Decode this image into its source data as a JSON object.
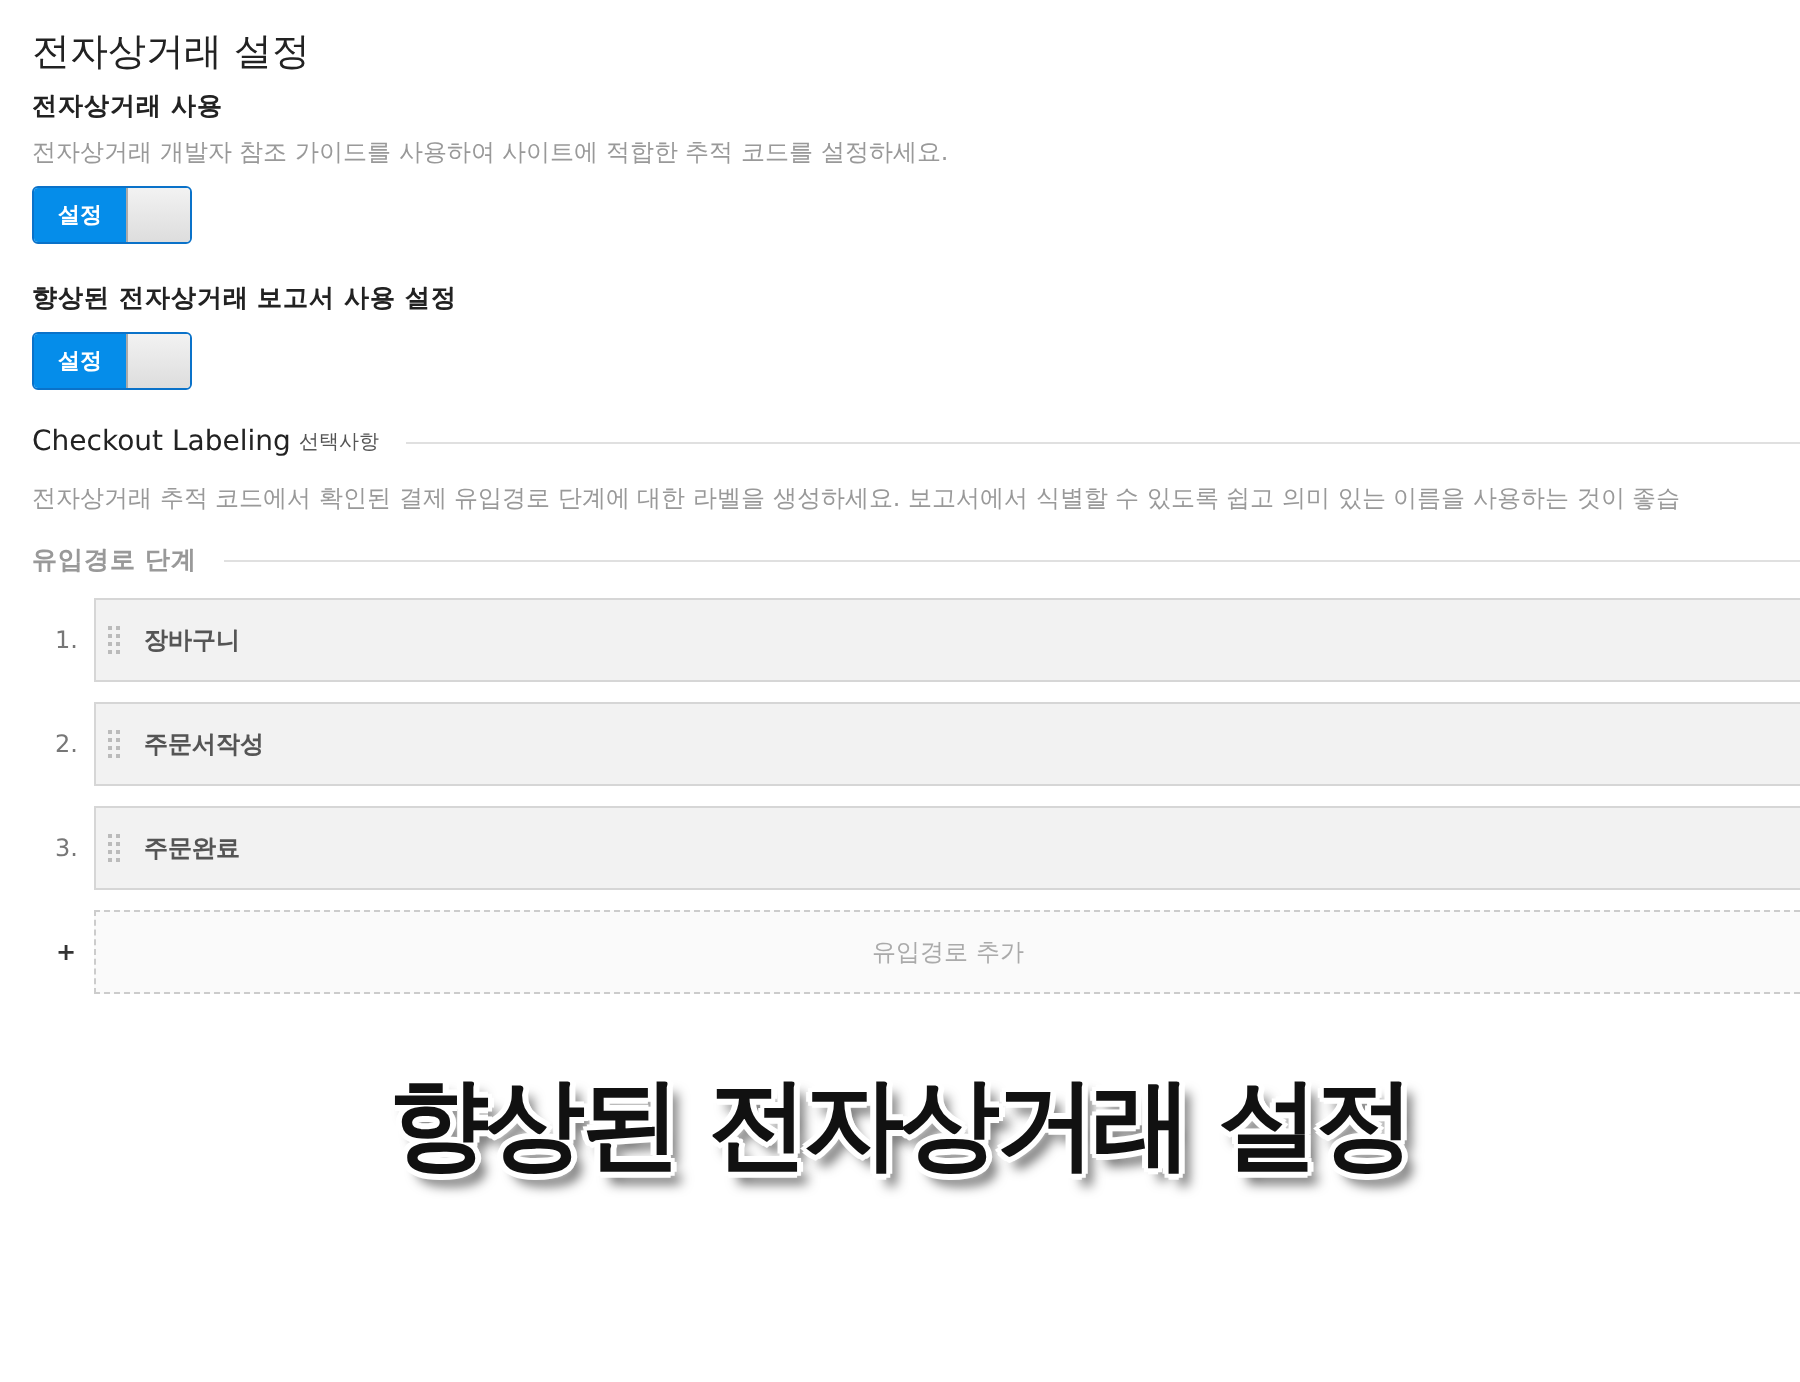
{
  "title": "전자상거래 설정",
  "settings": [
    {
      "label": "전자상거래 사용",
      "description": "전자상거래 개발자 참조 가이드를 사용하여 사이트에 적합한 추적 코드를 설정하세요.",
      "toggle": {
        "label": "설정",
        "on": true
      }
    },
    {
      "label": "향상된 전자상거래 보고서 사용 설정",
      "toggle": {
        "label": "설정",
        "on": true
      }
    }
  ],
  "checkout": {
    "title": "Checkout Labeling",
    "optional": "선택사항",
    "description": "전자상거래 추적 코드에서 확인된 결제 유입경로 단계에 대한 라벨을 생성하세요. 보고서에서 식별할 수 있도록 쉽고 의미 있는 이름을 사용하는 것이 좋습",
    "steps_heading": "유입경로 단계",
    "steps": [
      {
        "number": "1.",
        "name": "장바구니"
      },
      {
        "number": "2.",
        "name": "주문서작성"
      },
      {
        "number": "3.",
        "name": "주문완료"
      }
    ],
    "add": {
      "symbol": "+",
      "label": "유입경로 추가"
    }
  },
  "caption": "향상된 전자상거래 설정"
}
